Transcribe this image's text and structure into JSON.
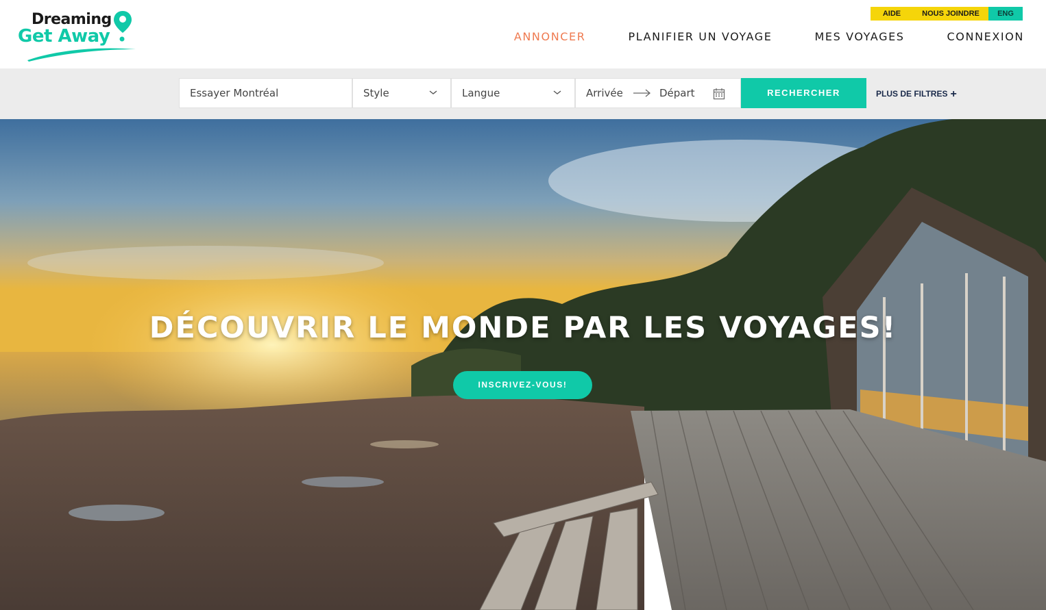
{
  "brand": {
    "line1": "Dreaming",
    "line2": "Get Away",
    "accent_color": "#10c9a8",
    "pin_icon": "location-pin-icon"
  },
  "utility_links": {
    "help": "AIDE",
    "contact": "NOUS JOINDRE",
    "language": "ENG",
    "colors": {
      "yellow": "#f5d50a",
      "teal": "#10c9a8"
    }
  },
  "nav": {
    "items": [
      {
        "label": "ANNONCER",
        "active": true
      },
      {
        "label": "PLANIFIER UN VOYAGE"
      },
      {
        "label": "MES VOYAGES"
      },
      {
        "label": "CONNEXION"
      }
    ],
    "active_color": "#ef7a50"
  },
  "search": {
    "query_placeholder": "Essayer Montréal",
    "style_label": "Style",
    "language_label": "Langue",
    "arrival_label": "Arrivée",
    "departure_label": "Départ",
    "search_button": "RECHERCHER",
    "more_filters": "PLUS DE FILTRES",
    "more_filters_symbol": "+"
  },
  "hero": {
    "title": "DÉCOUVRIR LE MONDE PAR LES VOYAGES!",
    "cta": "INSCRIVEZ-VOUS!"
  }
}
